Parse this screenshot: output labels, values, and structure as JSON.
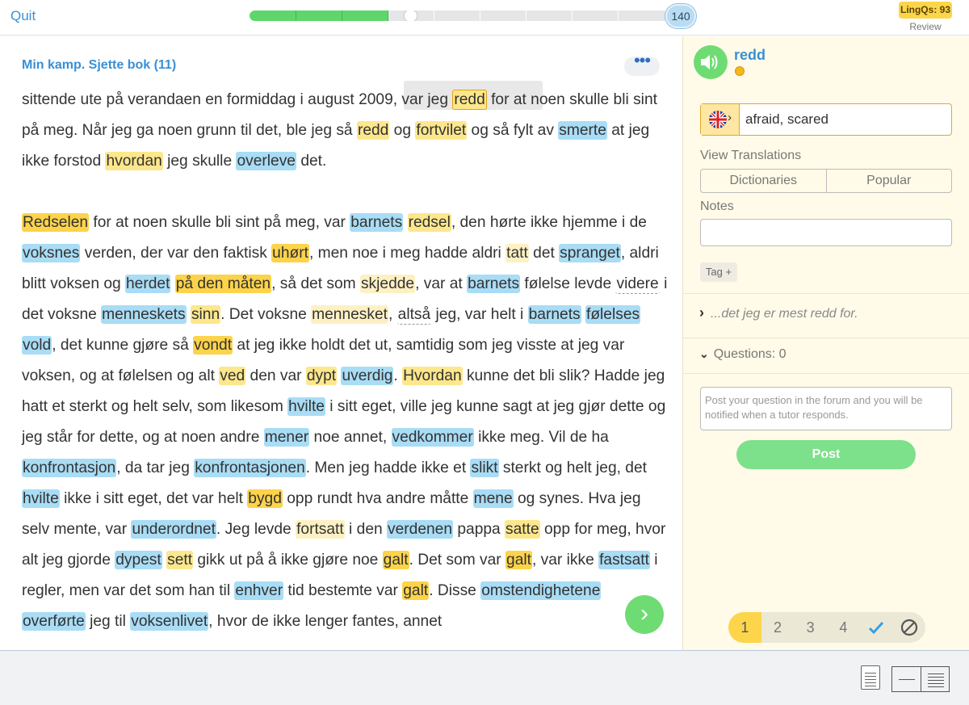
{
  "topbar": {
    "quit_label": "Quit",
    "progress_fraction": 0.33,
    "count": "140",
    "lingqs_label": "LingQs: 93",
    "review_label": "Review"
  },
  "lesson": {
    "title": "Min kamp. Sjette bok (11)",
    "more_label": "•••"
  },
  "panel": {
    "word": "redd",
    "hint": "afraid, scared",
    "view_translations_label": "View Translations",
    "dictionaries_label": "Dictionaries",
    "popular_label": "Popular",
    "notes_label": "Notes",
    "tag_label": "Tag +",
    "phrase": "...det jeg er mest redd for.",
    "questions_label": "Questions: 0",
    "question_placeholder": "Post your question in the forum and you will be notified when a tutor responds.",
    "post_label": "Post",
    "status_levels": [
      "1",
      "2",
      "3",
      "4"
    ],
    "known_icon": "check-icon",
    "ignore_icon": "ignore-icon"
  },
  "colors": {
    "accent_blue": "#3a8fd6",
    "lingq_blue": "#a9dcf5",
    "lingq_yellow": "#fde78c",
    "known_green": "#6fdc73"
  },
  "paragraphs": [
    [
      [
        "sittende ute på verandaen en formiddag i august 2009, var jeg ",
        ""
      ],
      [
        "redd",
        "sel"
      ],
      [
        " for at noen skulle bli sint på meg. Når jeg ga noen grunn til det, ble jeg så ",
        ""
      ],
      [
        "redd",
        "y"
      ],
      [
        " og ",
        ""
      ],
      [
        "fortvilet",
        "y"
      ],
      [
        " og så fylt av ",
        ""
      ],
      [
        "smerte",
        "b"
      ],
      [
        " at jeg ikke forstod ",
        ""
      ],
      [
        "hvordan",
        "y"
      ],
      [
        " jeg skulle ",
        ""
      ],
      [
        "overleve",
        "b"
      ],
      [
        " det.",
        ""
      ]
    ],
    [
      [
        "Redselen",
        "o"
      ],
      [
        " for at noen skulle bli sint på meg, var ",
        ""
      ],
      [
        "barnets",
        "b"
      ],
      [
        " ",
        ""
      ],
      [
        "redsel",
        "y"
      ],
      [
        ", den hørte ikke hjemme i de ",
        ""
      ],
      [
        "voksnes",
        "b"
      ],
      [
        " verden, der var den faktisk ",
        ""
      ],
      [
        "uhørt",
        "o"
      ],
      [
        ", men noe i meg hadde aldri ",
        ""
      ],
      [
        "tatt",
        "lb"
      ],
      [
        " det ",
        ""
      ],
      [
        "spranget",
        "b"
      ],
      [
        ", aldri blitt voksen og ",
        ""
      ],
      [
        "herdet",
        "b"
      ],
      [
        " ",
        ""
      ],
      [
        "på den måten",
        "o"
      ],
      [
        ", så det som ",
        ""
      ],
      [
        "skjedde",
        "lb"
      ],
      [
        ", var at ",
        ""
      ],
      [
        "barnets",
        "b"
      ],
      [
        " følelse levde ",
        ""
      ],
      [
        "videre",
        "dotted"
      ],
      [
        " i det voksne ",
        ""
      ],
      [
        "menneskets",
        "b"
      ],
      [
        " ",
        ""
      ],
      [
        "sinn",
        "y"
      ],
      [
        ". Det voksne ",
        ""
      ],
      [
        "mennesket",
        "lb"
      ],
      [
        ", ",
        ""
      ],
      [
        "altså",
        "dotted"
      ],
      [
        " jeg, var helt i ",
        ""
      ],
      [
        "barnets",
        "b"
      ],
      [
        " ",
        ""
      ],
      [
        "følelses",
        "b"
      ],
      [
        " ",
        ""
      ],
      [
        "vold",
        "b"
      ],
      [
        ", det kunne gjøre så ",
        ""
      ],
      [
        "vondt",
        "o"
      ],
      [
        " at jeg ikke holdt det ut, samtidig som jeg visste at jeg var voksen, og at følelsen og alt ",
        ""
      ],
      [
        "ved",
        "y"
      ],
      [
        " den var ",
        ""
      ],
      [
        "dypt",
        "y"
      ],
      [
        " ",
        ""
      ],
      [
        "uverdig",
        "b"
      ],
      [
        ". ",
        ""
      ],
      [
        "Hvordan",
        "y"
      ],
      [
        " kunne det bli slik? Hadde jeg hatt et sterkt og helt selv, som likesom ",
        ""
      ],
      [
        "hvilte",
        "b"
      ],
      [
        " i sitt eget, ville jeg kunne sagt at jeg gjør dette og jeg står for dette, og at noen andre ",
        ""
      ],
      [
        "mener",
        "b"
      ],
      [
        " noe annet, ",
        ""
      ],
      [
        "vedkommer",
        "b"
      ],
      [
        " ikke meg. Vil de ha ",
        ""
      ],
      [
        "konfrontasjon",
        "b"
      ],
      [
        ", da tar jeg ",
        ""
      ],
      [
        "konfrontasjonen",
        "b"
      ],
      [
        ". Men jeg hadde ikke et ",
        ""
      ],
      [
        "slikt",
        "b"
      ],
      [
        " sterkt og helt jeg, det ",
        ""
      ],
      [
        "hvilte",
        "b"
      ],
      [
        " ikke i sitt eget, det var helt ",
        ""
      ],
      [
        "bygd",
        "o"
      ],
      [
        " opp rundt hva andre måtte ",
        ""
      ],
      [
        "mene",
        "b"
      ],
      [
        " og synes. Hva jeg selv mente, var ",
        ""
      ],
      [
        "underordnet",
        "b"
      ],
      [
        ". Jeg levde ",
        ""
      ],
      [
        "fortsatt",
        "lb"
      ],
      [
        " i den ",
        ""
      ],
      [
        "verdenen",
        "b"
      ],
      [
        " pappa ",
        ""
      ],
      [
        "satte",
        "y"
      ],
      [
        " opp for meg, hvor alt jeg gjorde ",
        ""
      ],
      [
        "dypest",
        "b"
      ],
      [
        " ",
        ""
      ],
      [
        "sett",
        "y"
      ],
      [
        " gikk ut på å ikke gjøre noe ",
        ""
      ],
      [
        "galt",
        "o"
      ],
      [
        ". Det som var ",
        ""
      ],
      [
        "galt",
        "o"
      ],
      [
        ", var ikke ",
        ""
      ],
      [
        "fastsatt",
        "b"
      ],
      [
        " i regler, men var det som han til ",
        ""
      ],
      [
        "enhver",
        "b"
      ],
      [
        " tid bestemte var ",
        ""
      ],
      [
        "galt",
        "o"
      ],
      [
        ". Disse ",
        ""
      ],
      [
        "omstendighetene",
        "b"
      ],
      [
        " ",
        ""
      ],
      [
        "overførte",
        "b"
      ],
      [
        " jeg til ",
        ""
      ],
      [
        "voksenlivet",
        "b"
      ],
      [
        ", hvor de ikke lenger fantes, annet",
        ""
      ]
    ]
  ]
}
